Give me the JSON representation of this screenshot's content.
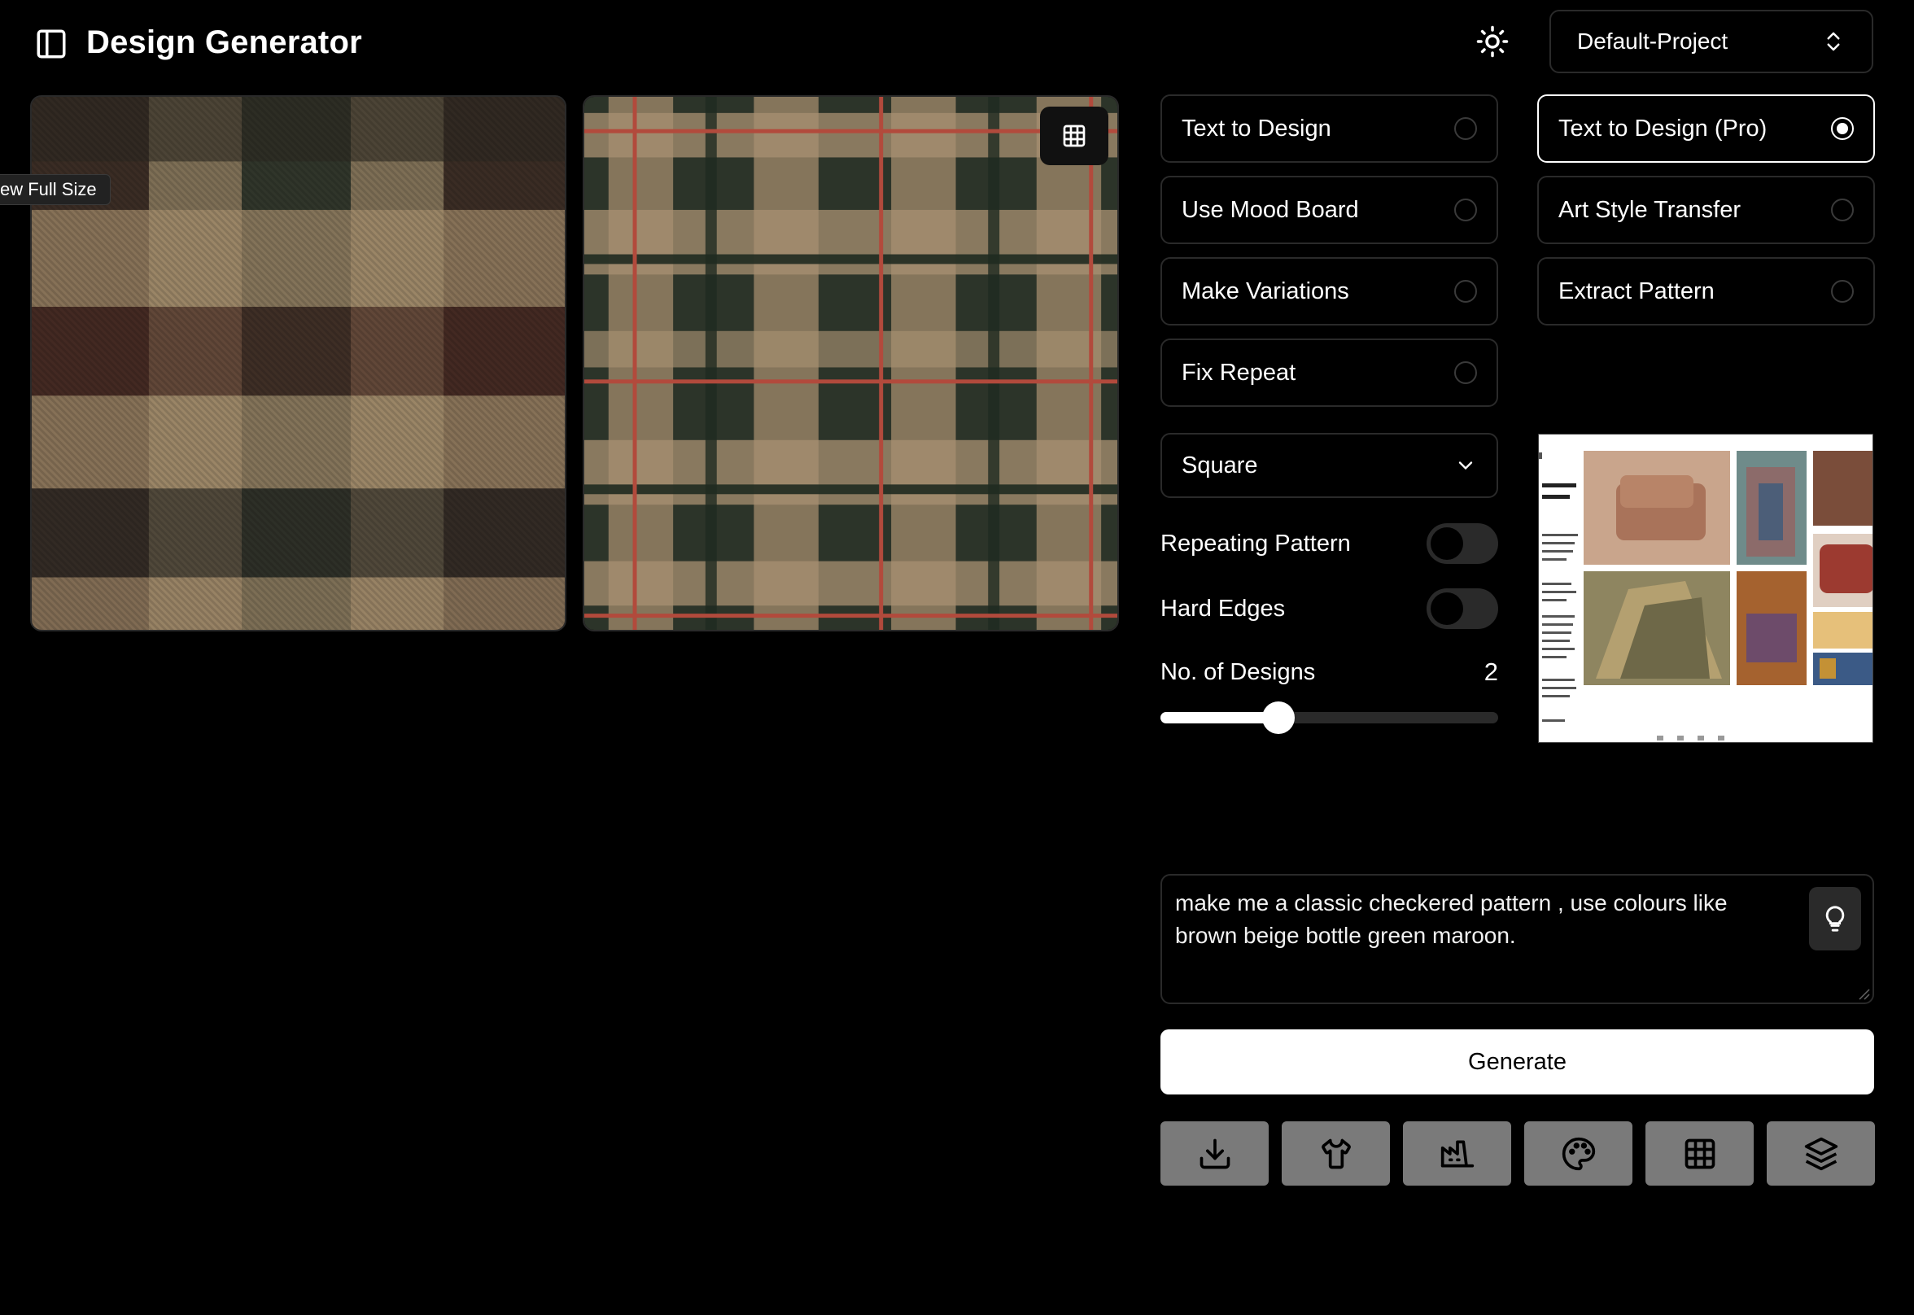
{
  "header": {
    "title": "Design Generator",
    "sidebar_toggle_icon": "sidebar-panel-icon",
    "theme_icon": "sun-icon",
    "project": "Default-Project"
  },
  "gallery": {
    "images": [
      {
        "name": "brown-beige-green-check",
        "colors": [
          "#3a2a22",
          "#a68e6d",
          "#2f382c",
          "#4a2b22"
        ]
      },
      {
        "name": "green-beige-red-tartan",
        "colors": [
          "#2c3529",
          "#a89072",
          "#a34a3c"
        ]
      }
    ],
    "tooltip": "ew Full Size",
    "grid_icon": "grid-icon"
  },
  "modes": {
    "left": [
      {
        "label": "Text to Design",
        "selected": false
      },
      {
        "label": "Use Mood Board",
        "selected": false
      },
      {
        "label": "Make Variations",
        "selected": false
      },
      {
        "label": "Fix Repeat",
        "selected": false
      }
    ],
    "right": [
      {
        "label": "Text to Design (Pro)",
        "selected": true
      },
      {
        "label": "Art Style Transfer",
        "selected": false
      },
      {
        "label": "Extract Pattern",
        "selected": false
      }
    ]
  },
  "settings": {
    "aspect": "Square",
    "repeating_label": "Repeating Pattern",
    "repeating_on": false,
    "hard_edges_label": "Hard Edges",
    "hard_edges_on": false,
    "designs_label": "No. of Designs",
    "designs_value": "2",
    "designs_fraction": 0.35
  },
  "prompt": {
    "text": "make me a classic checkered pattern , use colours like brown beige bottle green maroon.",
    "idea_icon": "lightbulb-icon"
  },
  "generate_label": "Generate",
  "tools": [
    {
      "icon": "download-icon"
    },
    {
      "icon": "shirt-icon"
    },
    {
      "icon": "factory-icon"
    },
    {
      "icon": "palette-icon"
    },
    {
      "icon": "grid-icon"
    },
    {
      "icon": "layers-icon"
    }
  ]
}
